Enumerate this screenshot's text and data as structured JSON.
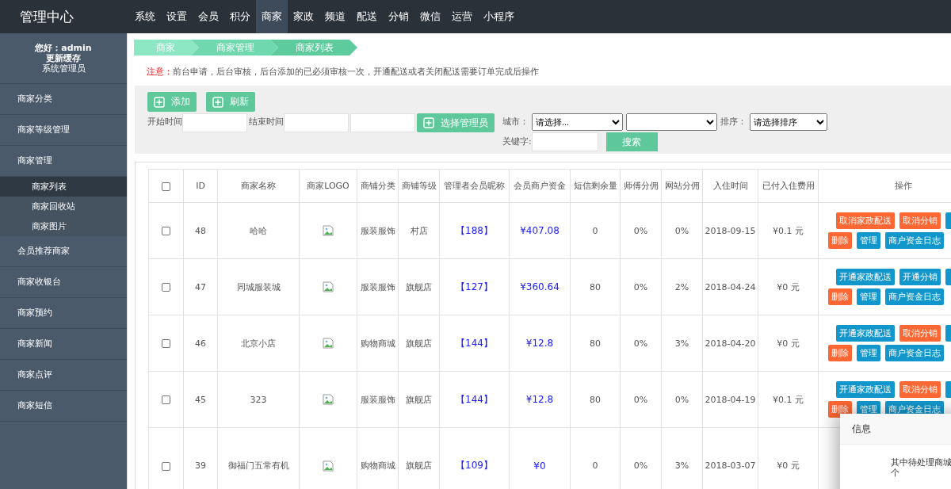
{
  "header": {
    "logo": "管理中心",
    "nav": [
      {
        "label": "系统",
        "selected": false
      },
      {
        "label": "设置",
        "selected": false
      },
      {
        "label": "会员",
        "selected": false
      },
      {
        "label": "积分",
        "selected": false
      },
      {
        "label": "商家",
        "selected": true
      },
      {
        "label": "家政",
        "selected": false
      },
      {
        "label": "频道",
        "selected": false
      },
      {
        "label": "配送",
        "selected": false
      },
      {
        "label": "分销",
        "selected": false
      },
      {
        "label": "微信",
        "selected": false
      },
      {
        "label": "运营",
        "selected": false
      },
      {
        "label": "小程序",
        "selected": false
      }
    ]
  },
  "sidebar": {
    "greeting": "您好：admin",
    "refresh_cache": "更新缓存",
    "role": "系统管理员",
    "items": [
      {
        "label": "商家分类",
        "selected": false
      },
      {
        "label": "商家等级管理",
        "selected": false
      },
      {
        "label": "商家管理",
        "selected": false,
        "children": [
          {
            "label": "商家列表",
            "selected": true
          },
          {
            "label": "商家回收站",
            "selected": false
          },
          {
            "label": "商家图片",
            "selected": false
          }
        ]
      },
      {
        "label": "会员推荐商家",
        "selected": false
      },
      {
        "label": "商家收银台",
        "selected": false
      },
      {
        "label": "商家预约",
        "selected": false
      },
      {
        "label": "商家新闻",
        "selected": false
      },
      {
        "label": "商家点评",
        "selected": false
      },
      {
        "label": "商家短信",
        "selected": false
      }
    ]
  },
  "breadcrumb": [
    "商家",
    "商家管理",
    "商家列表"
  ],
  "notice": {
    "label": "注意：",
    "text": "前台申请，后台审核，后台添加的已必须审核一次，开通配送或者关闭配送需要订单完成后操作"
  },
  "toolbar": {
    "buttons": [
      "添加",
      "刷新"
    ],
    "start_label": "开始时间",
    "end_label": "结束时间",
    "select_manager": "选择管理员",
    "city_label": "城市：",
    "city_placeholder": "请选择...",
    "sort_label": "排序：",
    "sort_placeholder": "请选择排序",
    "keyword_label": "关键字:",
    "search": "搜索"
  },
  "table": {
    "header_checked": false,
    "columns": [
      "ID",
      "商家名称",
      "商家LOGO",
      "商铺分类",
      "商铺等级",
      "管理者会员昵称",
      "会员商户资金",
      "短信剩余量",
      "师傅分佣",
      "网站分佣",
      "入住时间",
      "已付入住费用",
      "操作"
    ],
    "rows": [
      {
        "checked": false,
        "id": "48",
        "name": "哈哈",
        "category": "服装服饰",
        "level": "村店",
        "nickname": "【188】",
        "funds": "¥407.08",
        "sms": "0",
        "master_commission": "0%",
        "site_commission": "0%",
        "joined": "2018-09-15",
        "paid": "¥0.1 元",
        "actions": [
          {
            "label": "取消家政配送",
            "kind": "danger"
          },
          {
            "label": "取消分销",
            "kind": "danger"
          }
        ],
        "actions2": [
          {
            "label": "删除",
            "kind": "danger"
          },
          {
            "label": "管理",
            "kind": "primary"
          },
          {
            "label": "商户资金日志",
            "kind": "primary"
          }
        ]
      },
      {
        "checked": false,
        "id": "47",
        "name": "同城服装城",
        "category": "服装服饰",
        "level": "旗舰店",
        "nickname": "【127】",
        "funds": "¥360.64",
        "sms": "80",
        "master_commission": "0%",
        "site_commission": "2%",
        "joined": "2018-04-24",
        "paid": "¥0 元",
        "actions": [
          {
            "label": "开通家政配送",
            "kind": "primary"
          },
          {
            "label": "开通分销",
            "kind": "primary"
          }
        ],
        "actions2": [
          {
            "label": "删除",
            "kind": "danger"
          },
          {
            "label": "管理",
            "kind": "primary"
          },
          {
            "label": "商户资金日志",
            "kind": "primary"
          }
        ]
      },
      {
        "checked": false,
        "id": "46",
        "name": "北京小店",
        "category": "购物商城",
        "level": "旗舰店",
        "nickname": "【144】",
        "funds": "¥12.8",
        "sms": "80",
        "master_commission": "0%",
        "site_commission": "3%",
        "joined": "2018-04-20",
        "paid": "¥0 元",
        "actions": [
          {
            "label": "开通家政配送",
            "kind": "primary"
          },
          {
            "label": "取消分销",
            "kind": "danger"
          }
        ],
        "actions2": [
          {
            "label": "删除",
            "kind": "danger"
          },
          {
            "label": "管理",
            "kind": "primary"
          },
          {
            "label": "商户资金日志",
            "kind": "primary"
          }
        ]
      },
      {
        "checked": false,
        "id": "45",
        "name": "323",
        "category": "服装服饰",
        "level": "旗舰店",
        "nickname": "【144】",
        "funds": "¥12.8",
        "sms": "80",
        "master_commission": "0%",
        "site_commission": "0%",
        "joined": "2018-04-19",
        "paid": "¥0.1 元",
        "actions": [
          {
            "label": "开通家政配送",
            "kind": "primary"
          },
          {
            "label": "取消分销",
            "kind": "danger"
          }
        ],
        "actions2": [
          {
            "label": "删除",
            "kind": "danger"
          },
          {
            "label": "管理",
            "kind": "primary"
          },
          {
            "label": "商户资金日志",
            "kind": "primary"
          }
        ]
      },
      {
        "checked": false,
        "id": "39",
        "name": "御福门五常有机",
        "category": "购物商城",
        "level": "旗舰店",
        "nickname": "【109】",
        "funds": "¥0",
        "sms": "0",
        "master_commission": "0%",
        "site_commission": "3%",
        "joined": "2018-03-07",
        "paid": "¥0 元"
      }
    ]
  },
  "dialog": {
    "title": "信息",
    "message": "其中待处理商城",
    "message_line2": "个"
  }
}
